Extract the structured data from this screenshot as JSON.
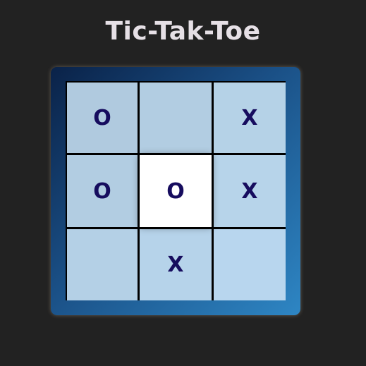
{
  "title": "Tic-Tak-Toe",
  "board": {
    "cells": [
      [
        "O",
        "",
        "X"
      ],
      [
        "O",
        "O",
        "X"
      ],
      [
        "",
        "X",
        ""
      ]
    ],
    "highlighted_cell": {
      "row": 1,
      "col": 1
    }
  },
  "colors": {
    "background": "#222222",
    "title": "#e6e0e6",
    "mark": "#160c5e",
    "cell": "#b2cfe4",
    "highlight": "#ffffff",
    "frame_start": "#0a2248",
    "frame_end": "#2e86c4"
  }
}
